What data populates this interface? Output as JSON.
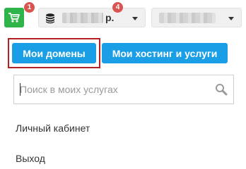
{
  "topbar": {
    "cart": {
      "icon": "cart-icon",
      "badge": "1",
      "color": "#2fb44a"
    },
    "balance": {
      "icon": "coins-icon",
      "currency": "р.",
      "badge": "4"
    },
    "user_menu": {
      "icon": "chevron-down-icon"
    }
  },
  "tabs": [
    {
      "label": "Мои домены",
      "active": true
    },
    {
      "label": "Мои хостинг и услуги",
      "active": false
    }
  ],
  "search": {
    "placeholder": "Поиск в моих услугах",
    "value": "",
    "icon": "search-icon"
  },
  "nav": {
    "cabinet": "Личный кабинет",
    "logout": "Выход"
  },
  "colors": {
    "accent": "#1a9ee6",
    "badge": "#d9534f",
    "highlight_frame": "#b52025"
  }
}
